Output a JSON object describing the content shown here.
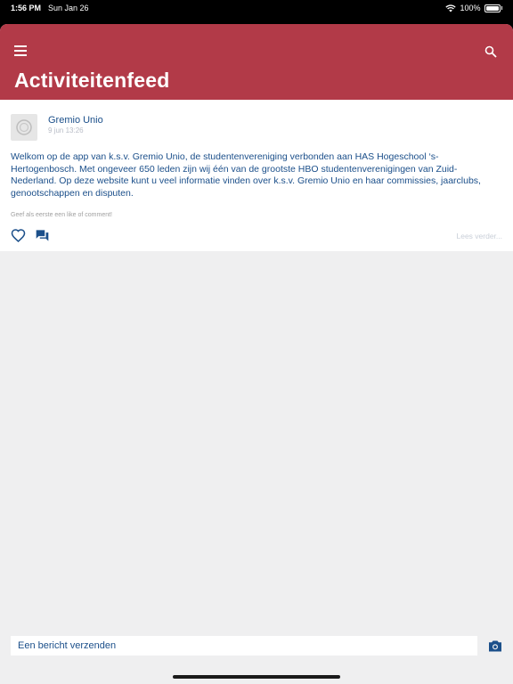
{
  "status_bar": {
    "time": "1:56 PM",
    "date": "Sun Jan 26",
    "battery": "100%"
  },
  "header": {
    "title": "Activiteitenfeed",
    "menu_icon": "hamburger-icon",
    "search_icon": "search-icon"
  },
  "post": {
    "author": "Gremio Unio",
    "timestamp": "9 jun 13:26",
    "body": "Welkom op de app van k.s.v. Gremio Unio, de studentenvereniging verbonden aan HAS Hogeschool ‘s-Hertogenbosch. Met ongeveer 650 leden zijn wij één van de grootste HBO studentenverenigingen van Zuid-Nederland. Op deze website kunt u veel informatie vinden over k.s.v. Gremio Unio en haar commissies, jaarclubs, genootschappen en disputen.",
    "hint": "Geef als eerste een like of comment!",
    "read_more": "Lees verder..."
  },
  "compose": {
    "placeholder": "Een bericht verzenden"
  },
  "colors": {
    "header_bg": "#b23a48",
    "accent_blue": "#1b4f8a"
  }
}
